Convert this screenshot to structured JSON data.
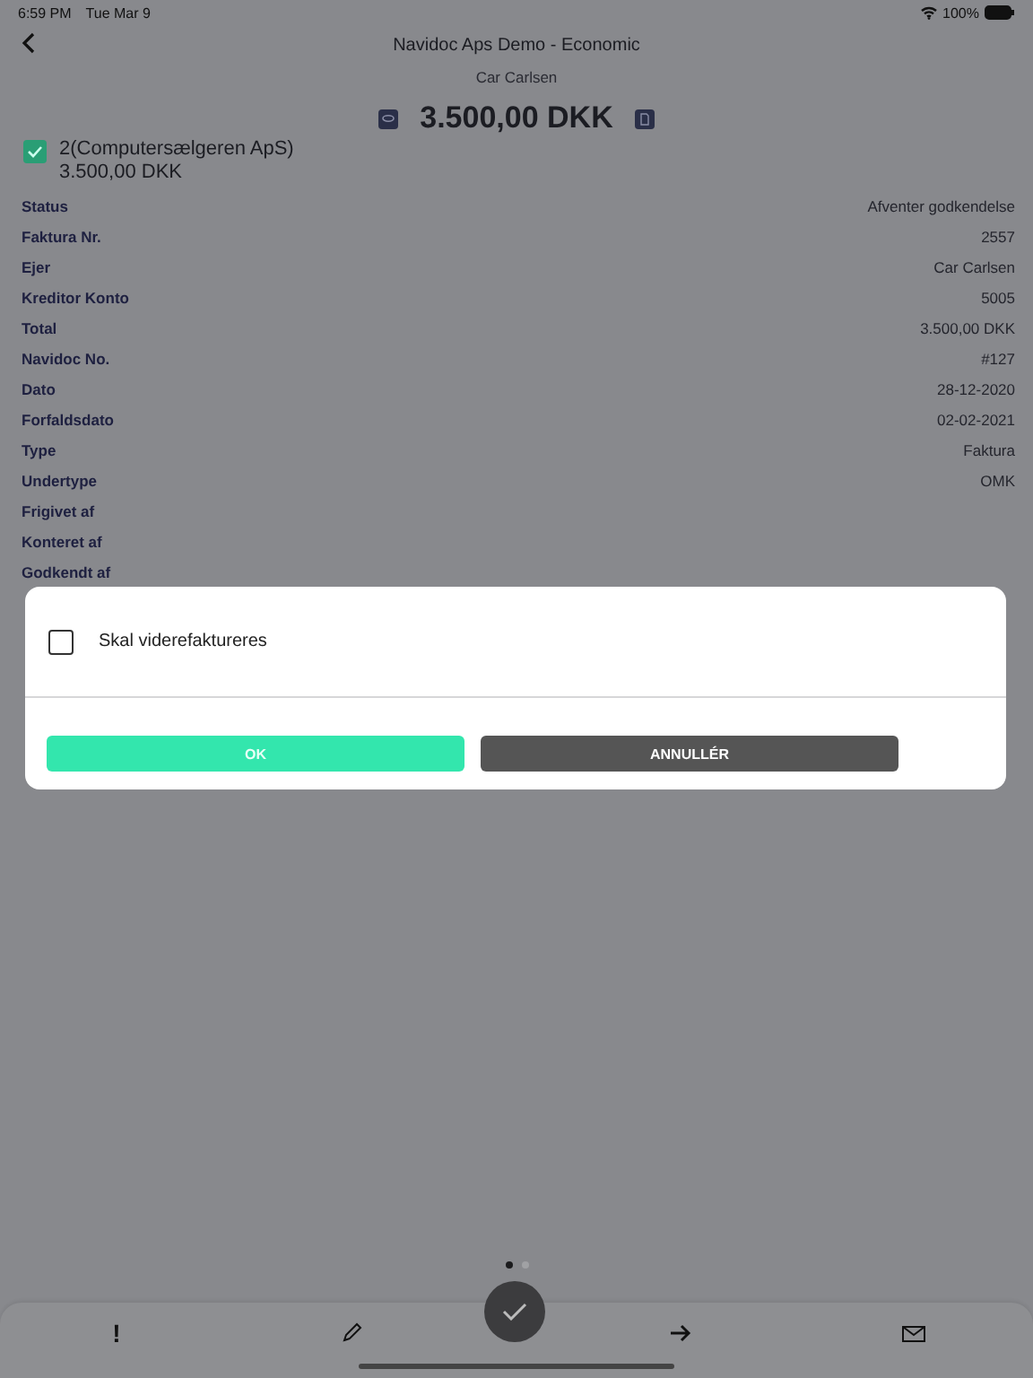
{
  "status_bar": {
    "time": "6:59 PM",
    "date": "Tue Mar 9",
    "battery": "100%"
  },
  "header": {
    "title": "Navidoc Aps Demo - Economic",
    "subtitle": "Car Carlsen",
    "amount": "3.500,00 DKK"
  },
  "account": {
    "checked": true,
    "name": "2(Computersælgeren ApS)",
    "amount": "3.500,00 DKK"
  },
  "details": [
    {
      "label": "Status",
      "value": "Afventer godkendelse"
    },
    {
      "label": "Faktura Nr.",
      "value": "2557"
    },
    {
      "label": "Ejer",
      "value": "Car Carlsen"
    },
    {
      "label": "Kreditor Konto",
      "value": "5005"
    },
    {
      "label": "Total",
      "value": "3.500,00 DKK"
    },
    {
      "label": "Navidoc No.",
      "value": "#127"
    },
    {
      "label": "Dato",
      "value": "28-12-2020"
    },
    {
      "label": "Forfaldsdato",
      "value": "02-02-2021"
    },
    {
      "label": "Type",
      "value": "Faktura"
    },
    {
      "label": "Undertype",
      "value": "OMK"
    },
    {
      "label": "Frigivet af"
    },
    {
      "label": "Konteret af"
    },
    {
      "label": "Godkendt af"
    }
  ],
  "dialog": {
    "checkbox": {
      "label": "Skal viderefaktureres",
      "checked": false
    },
    "buttons": [
      {
        "label": "OK",
        "kind": "primary"
      },
      {
        "label": "ANNULLÉR",
        "kind": "secondary"
      }
    ]
  },
  "pager": [
    {
      "selected": true
    },
    {
      "selected": false
    }
  ],
  "toolbar": [
    {
      "kind": "text",
      "label": "!"
    },
    {
      "kind": "edit"
    },
    {
      "kind": "approve"
    },
    {
      "kind": "forward"
    },
    {
      "kind": "mail"
    }
  ]
}
